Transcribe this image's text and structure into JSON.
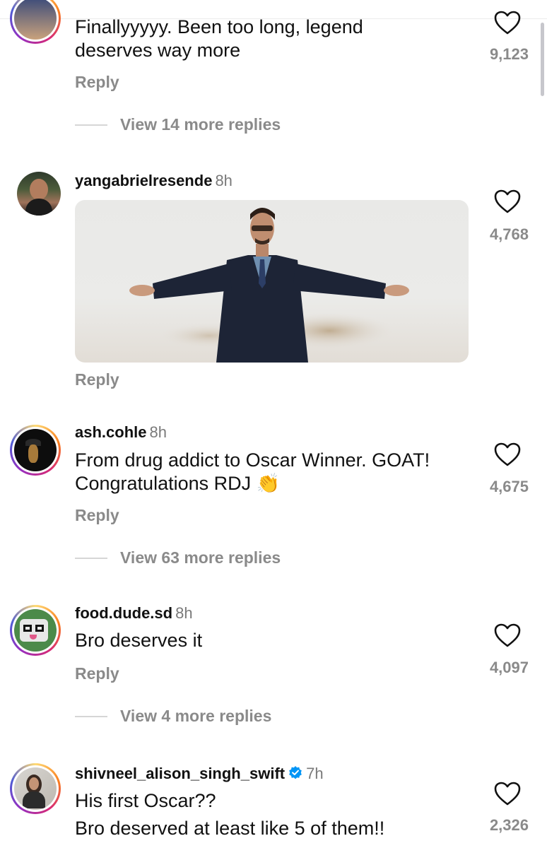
{
  "comments": [
    {
      "username": "",
      "time": "",
      "text_lines": [
        "Finallyyyyy. Been too long, legend",
        "deserves way more"
      ],
      "likes": "9,123",
      "reply_label": "Reply",
      "more_replies": "View 14 more replies"
    },
    {
      "username": "yangabrielresende",
      "time": "8h",
      "text_lines": [],
      "media": "gif",
      "likes": "4,768",
      "reply_label": "Reply"
    },
    {
      "username": "ash.cohle",
      "time": "8h",
      "text_lines": [
        "From drug addict to Oscar Winner. GOAT!",
        "Congratulations RDJ 👏"
      ],
      "likes": "4,675",
      "reply_label": "Reply",
      "more_replies": "View 63 more replies"
    },
    {
      "username": "food.dude.sd",
      "time": "8h",
      "text_lines": [
        "Bro deserves it"
      ],
      "likes": "4,097",
      "reply_label": "Reply",
      "more_replies": "View 4 more replies"
    },
    {
      "username": "shivneel_alison_singh_swift",
      "time": "7h",
      "verified": true,
      "text_lines": [
        "His first Oscar??",
        "Bro deserved at least like 5 of them!!"
      ],
      "likes": "2,326"
    }
  ],
  "icons": {
    "like": "heart-outline-icon",
    "verified": "verified-badge-icon"
  },
  "colors": {
    "secondary_text": "#8a8a8a",
    "verified_blue": "#0095f6",
    "story_ring": [
      "#feda75",
      "#fa7e1e",
      "#d62976",
      "#962fbf",
      "#4f5bd5"
    ]
  }
}
